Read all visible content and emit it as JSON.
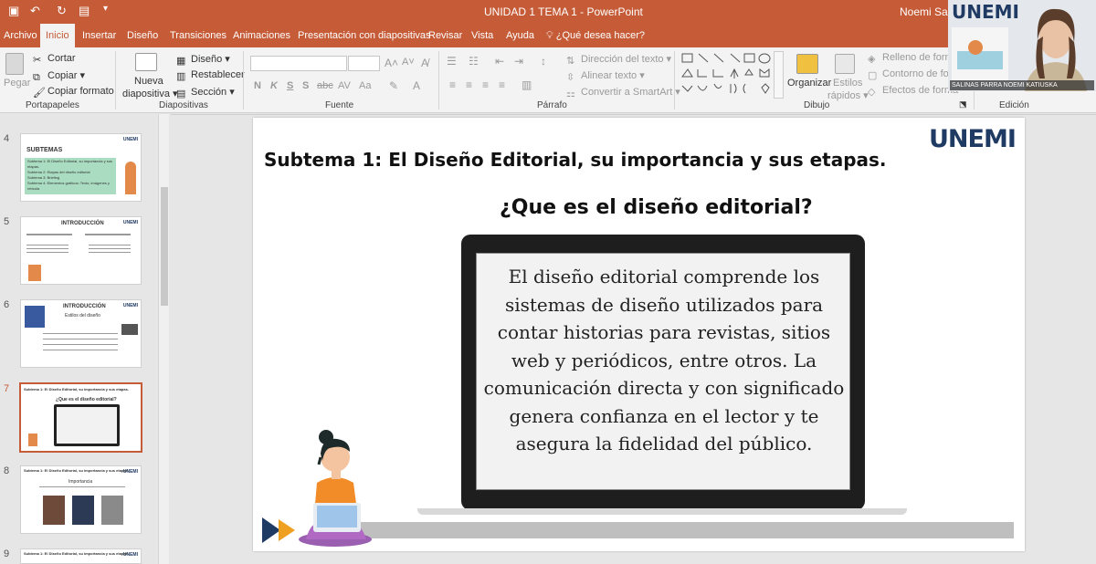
{
  "window": {
    "title": "UNIDAD 1 TEMA 1  -  PowerPoint",
    "user": "Noemi Salinas"
  },
  "tabs": [
    "Archivo",
    "Inicio",
    "Insertar",
    "Diseño",
    "Transiciones",
    "Animaciones",
    "Presentación con diapositivas",
    "Revisar",
    "Vista",
    "Ayuda"
  ],
  "tell_me": "¿Qué desea hacer?",
  "ribbon": {
    "clipboard": {
      "paste": "Pegar",
      "cut": "Cortar",
      "copy": "Copiar",
      "format_painter": "Copiar formato",
      "group": "Portapapeles"
    },
    "slides": {
      "new_slide_line1": "Nueva",
      "new_slide_line2": "diapositiva",
      "layout": "Diseño",
      "reset": "Restablecer",
      "section": "Sección",
      "group": "Diapositivas"
    },
    "font": {
      "group": "Fuente",
      "bold": "N",
      "italic": "K",
      "underline": "S",
      "shadow": "S",
      "strike": "abc",
      "spacing": "AV",
      "case": "Aa"
    },
    "paragraph": {
      "text_direction": "Dirección del texto",
      "align_text": "Alinear texto",
      "smartart": "Convertir a SmartArt",
      "group": "Párrafo"
    },
    "drawing": {
      "arrange": "Organizar",
      "styles_line1": "Estilos",
      "styles_line2": "rápidos",
      "fill": "Relleno de forma",
      "outline": "Contorno de forma",
      "effects": "Efectos de forma",
      "group": "Dibujo"
    },
    "editing": {
      "group": "Edición"
    }
  },
  "thumbnails": [
    {
      "num": "4",
      "title": "SUBTEMAS",
      "lines": [
        "Subtema 1: El Diseño Editorial, su importancia y sus etapas.",
        "Subtema 2: Etapas del diseño editorial",
        "Subtema 3: Briefing",
        "Subtema 4: Elementos gráficos: Texto, imágenes y retícula"
      ]
    },
    {
      "num": "5",
      "title": "INTRODUCCIÓN"
    },
    {
      "num": "6",
      "title": "INTRODUCCIÓN",
      "subtitle": "Estilos del diseño"
    },
    {
      "num": "7",
      "title": "Subtema 1: El Diseño Editorial, su importancia y sus etapas.",
      "subtitle": "¿Que es el diseño editorial?"
    },
    {
      "num": "8",
      "title": "Subtema 1: El Diseño Editorial, su importancia y sus etapas.",
      "subtitle": "Importancia"
    },
    {
      "num": "9",
      "title": "Subtema 1: El Diseño Editorial, su importancia y sus etapas."
    }
  ],
  "slide": {
    "brand": "UNEMI",
    "title": "Subtema 1: El Diseño Editorial, su importancia y sus etapas.",
    "question": "¿Que es el diseño editorial?",
    "body": "El diseño editorial comprende los sistemas de diseño utilizados para contar historias para revistas, sitios web y periódicos, entre otros. La comunicación directa y con significado genera confianza en el lector y te asegura la fidelidad del público."
  },
  "webcam": {
    "brand": "UNEMI",
    "name": "SALINAS PARRA NOEMI KATIUSKA"
  },
  "colors": {
    "accent": "#c65b37",
    "brand": "#1f3a63"
  }
}
